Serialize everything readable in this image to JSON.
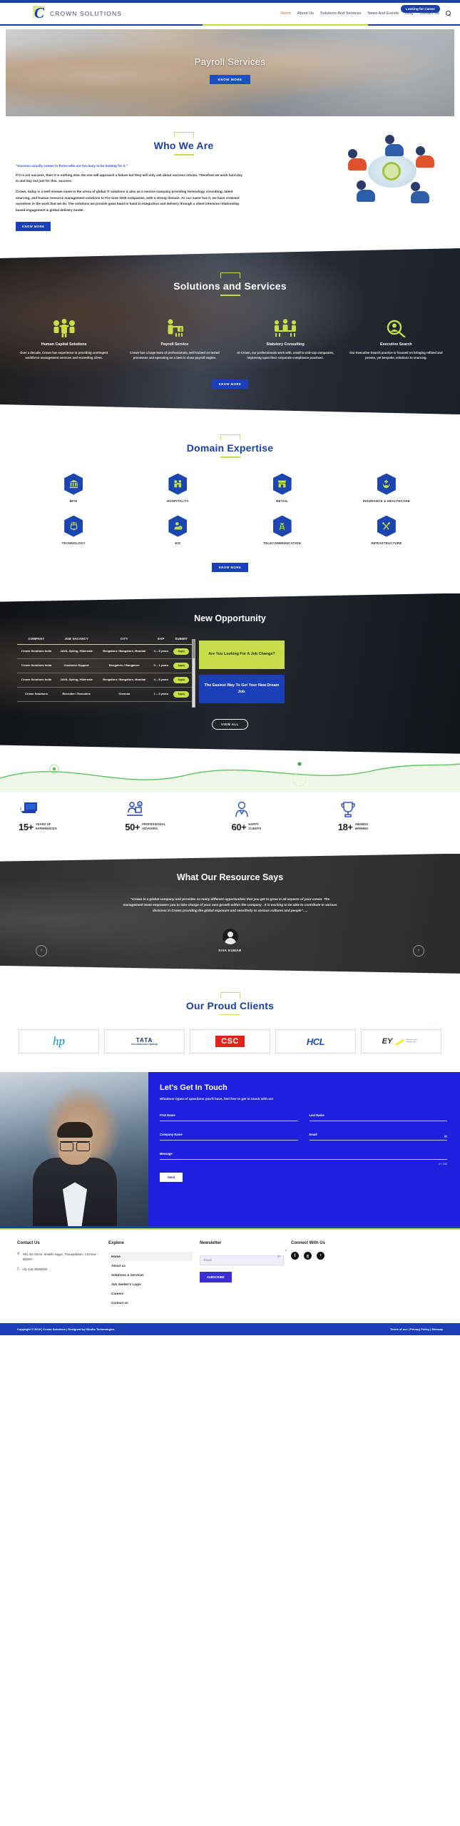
{
  "site": {
    "brand": "CROWN SOLUTIONS",
    "career_button": "Looking for Career",
    "search_icon": "search-icon"
  },
  "nav": [
    {
      "label": "Home",
      "active": true
    },
    {
      "label": "About Us",
      "active": false
    },
    {
      "label": "Solutions And Services",
      "active": false
    },
    {
      "label": "News And Events",
      "active": false
    },
    {
      "label": "Blog",
      "active": false
    },
    {
      "label": "Contact Us",
      "active": false
    }
  ],
  "hero": {
    "title": "Payroll Services",
    "button": "KNOW MORE"
  },
  "who": {
    "heading": "Who We Are",
    "quote": "\"Success usually comes to those who are too busy to be looking for it.\"",
    "p1": "If it is not success, then it is nothing else. No one will approach a failure but they will only ask about success stories. Therefore we work hard day in and day out just for this, success.",
    "p2": "Crown, today is a well renown name in the arena of global IT solutions & also as a service company providing technology consulting, talent sourcing, and human resource management solutions to For-tune 1000 companies, with a strong domain. As our name has it, we have crowned ourselves in the work that we do. The solutions we provide goes hand in hand in integration and delivery through a client intensive relationship based engagement & global delivery model.",
    "button": "KNOW MORE"
  },
  "solutions": {
    "heading": "Solutions and Services",
    "button": "KNOW MORE",
    "cards": [
      {
        "icon": "human-capital-icon",
        "title": "Human Capital Solutions",
        "desc": "Over a decade, Crown has experience in providing contingent workforce management services and exceeding client."
      },
      {
        "icon": "payroll-icon",
        "title": "Payroll Service",
        "desc": "Crown has a large team of professionals, well trained on tested processes and operating on a best in class payroll engine."
      },
      {
        "icon": "statutory-icon",
        "title": "Statutory Consulting",
        "desc": "At Crown, our professionals work with, small to mid-cap companies, improving upon their corporate compliance practices."
      },
      {
        "icon": "executive-search-icon",
        "title": "Executive Search",
        "desc": "Our Executive Search practice is focused on bringing refined and proven, yet bespoke, solutions to sourcing."
      }
    ]
  },
  "domain": {
    "heading": "Domain Expertise",
    "button": "KNOW MORE",
    "items": [
      {
        "label": "BFSI",
        "icon": "bank-icon"
      },
      {
        "label": "HOSPITALITY",
        "icon": "people-icon"
      },
      {
        "label": "RETAIL",
        "icon": "store-icon"
      },
      {
        "label": "INSURANCE & HEALTHCARE",
        "icon": "hands-heart-icon"
      },
      {
        "label": "TECHNOLOGY",
        "icon": "monitor-icon"
      },
      {
        "label": "EIS",
        "icon": "user-info-icon"
      },
      {
        "label": "TELECOMMUNICATION",
        "icon": "tower-icon"
      },
      {
        "label": "INFRASTRUCTURE",
        "icon": "tools-icon"
      }
    ]
  },
  "opportunity": {
    "heading": "New Opportunity",
    "view_all": "VIEW ALL",
    "columns": [
      "COMPANY",
      "JOB VACANCY",
      "CITY",
      "EXP",
      "SUBMIT"
    ],
    "rows": [
      {
        "company": "Crown Solutions India",
        "vacancy": "JAVA, Spring, Hibernate",
        "city": "Bengaluru / Bangalore, Mumbai",
        "exp": "4 – 8 years",
        "submit": "Apply"
      },
      {
        "company": "Crown Solutions India",
        "vacancy": "Customer Support",
        "city": "Bengaluru / Bangalore",
        "exp": "0 – 1 years",
        "submit": "Apply"
      },
      {
        "company": "Crown Solutions India",
        "vacancy": "JAVA, Spring, Hibernate",
        "city": "Bengaluru / Bangalore, Mumbai",
        "exp": "4 – 8 years",
        "submit": "Apply"
      },
      {
        "company": "Crown Solutions",
        "vacancy": "Recruiter / Executive",
        "city": "Chennai",
        "exp": "1 – 3 years",
        "submit": "Apply"
      }
    ],
    "promo_green": "Are You Looking For A Job Change?",
    "promo_blue": "The Easiest Way To Get Your New Dream Job."
  },
  "stats": [
    {
      "value": "15+",
      "label_line1": "YEARS OF",
      "label_line2": "EXPERIENCES",
      "icon": "laptop-icon"
    },
    {
      "value": "50+",
      "label_line1": "PROFESSIONAL",
      "label_line2": "ADVISORS",
      "icon": "advisor-icon"
    },
    {
      "value": "60+",
      "label_line1": "HAPPY",
      "label_line2": "CLIENTS",
      "icon": "client-icon"
    },
    {
      "value": "18+",
      "label_line1": "AWARDS",
      "label_line2": "WINNING",
      "icon": "trophy-icon"
    }
  ],
  "testimonial": {
    "heading": "What Our Resource Says",
    "quote": "\"Crown is a global company and provides so many different opportunities that you get to grow in all aspects of your career. The management team empowers you to take charge of your own growth within the company . It is exciting to be able to contribute to various divisions in Crown providing the global exposure and sensitivity to various cultures and people\". ...",
    "author": "SIVA KUMAR",
    "prev_icon": "chevron-left-icon",
    "next_icon": "chevron-right-icon"
  },
  "clients": {
    "heading": "Our Proud Clients",
    "logos": [
      {
        "name": "hp",
        "text": "hp"
      },
      {
        "name": "tata",
        "text": "TATA",
        "sub": "TATA CONSULTANCY SERVICES"
      },
      {
        "name": "csc",
        "text": "CSC"
      },
      {
        "name": "hcl",
        "text": "HCL"
      },
      {
        "name": "ey",
        "text": "EY",
        "sub": "Building a better working world"
      }
    ]
  },
  "contact": {
    "heading": "Let's  Get In Touch",
    "subheading": "Whatever types of  questions you'll have, feel free to get in touch with us!",
    "fields": {
      "first_name": "First Name",
      "last_name": "Last Name",
      "company_name": "Company Name",
      "email": "Email",
      "message": "Message"
    },
    "counter": "0 / 100",
    "send_button": "Send"
  },
  "footer": {
    "contact": {
      "title": "Contact Us",
      "address": "#40, 5th Street, Shakthi Nagar, Thoraipakkam, Chennai – 600097",
      "phone": "+91-044-40066000"
    },
    "explore": {
      "title": "Explore",
      "links": [
        "Home",
        "About us",
        "Solutions & Services",
        "Job Seeker's Login",
        "Careers",
        "Contact us"
      ]
    },
    "newsletter": {
      "title": "Newsletter",
      "placeholder": "Email",
      "button": "SUBSCRIBE"
    },
    "connect": {
      "title": "Connect With Us",
      "socials": [
        "facebook-icon",
        "google-plus-icon",
        "twitter-icon"
      ]
    },
    "copyright": "Copyright © 2018 | Crown Solutions | Designed by iStudio Technologies",
    "legal": "Terms of use | Privacy Policy | Sitemap"
  },
  "colors": {
    "brand_blue": "#1a3fa8",
    "accent_green": "#c8dd4a",
    "contact_blue": "#1f1fe0",
    "active_nav": "#e8622c"
  }
}
